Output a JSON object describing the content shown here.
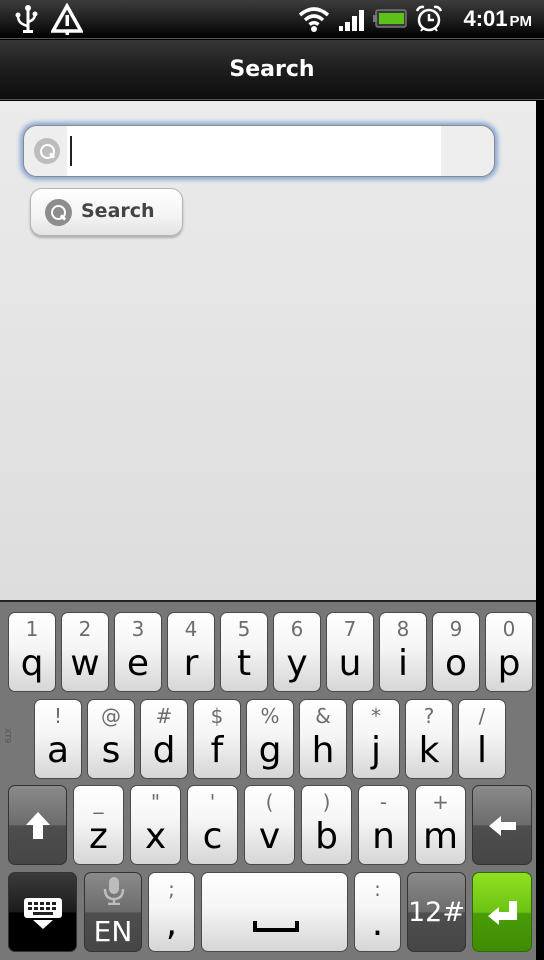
{
  "status_bar": {
    "left_icons": [
      "usb-icon",
      "warning-icon"
    ],
    "right_icons": [
      "wifi-icon",
      "signal-icon",
      "battery-icon",
      "alarm-icon"
    ],
    "time": "4:01",
    "ampm": "PM",
    "battery_color": "#5cc21a"
  },
  "title_bar": {
    "title": "Search"
  },
  "search": {
    "input_value": "",
    "input_placeholder": "",
    "button_label": "Search",
    "focus_glow_color": "#6e96d2"
  },
  "keyboard": {
    "side_label": "XT9",
    "rows": [
      [
        {
          "alt": "1",
          "main": "q"
        },
        {
          "alt": "2",
          "main": "w"
        },
        {
          "alt": "3",
          "main": "e"
        },
        {
          "alt": "4",
          "main": "r"
        },
        {
          "alt": "5",
          "main": "t"
        },
        {
          "alt": "6",
          "main": "y"
        },
        {
          "alt": "7",
          "main": "u"
        },
        {
          "alt": "8",
          "main": "i"
        },
        {
          "alt": "9",
          "main": "o"
        },
        {
          "alt": "0",
          "main": "p"
        }
      ],
      [
        {
          "alt": "!",
          "main": "a"
        },
        {
          "alt": "@",
          "main": "s"
        },
        {
          "alt": "#",
          "main": "d"
        },
        {
          "alt": "$",
          "main": "f"
        },
        {
          "alt": "%",
          "main": "g"
        },
        {
          "alt": "&",
          "main": "h"
        },
        {
          "alt": "*",
          "main": "j"
        },
        {
          "alt": "?",
          "main": "k"
        },
        {
          "alt": "/",
          "main": "l"
        }
      ],
      [
        {
          "alt": "_",
          "main": "z"
        },
        {
          "alt": "\"",
          "main": "x"
        },
        {
          "alt": "'",
          "main": "c"
        },
        {
          "alt": "(",
          "main": "v"
        },
        {
          "alt": ")",
          "main": "b"
        },
        {
          "alt": "-",
          "main": "n"
        },
        {
          "alt": "+",
          "main": "m"
        }
      ]
    ],
    "shift_icon": "shift-arrow-icon",
    "backspace_icon": "backspace-arrow-icon",
    "hide_keyboard_icon": "keyboard-hide-icon",
    "mic_icon": "microphone-icon",
    "language_label": "EN",
    "comma_key": {
      "alt": ";",
      "main": ","
    },
    "space_icon": "space-bar-icon",
    "period_key": {
      "alt": ":",
      "main": "."
    },
    "symbols_label": "12#",
    "enter_icon": "enter-arrow-icon",
    "enter_color": "#6cc314"
  }
}
